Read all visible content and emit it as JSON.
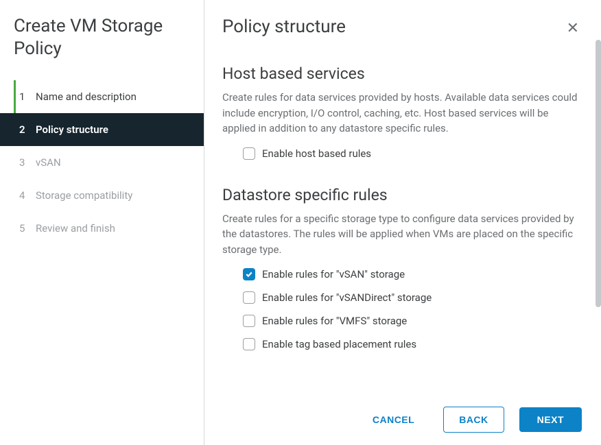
{
  "wizard": {
    "title": "Create VM Storage Policy"
  },
  "steps": [
    {
      "num": "1",
      "label": "Name and description",
      "state": "completed"
    },
    {
      "num": "2",
      "label": "Policy structure",
      "state": "active"
    },
    {
      "num": "3",
      "label": "vSAN",
      "state": "disabled"
    },
    {
      "num": "4",
      "label": "Storage compatibility",
      "state": "disabled"
    },
    {
      "num": "5",
      "label": "Review and finish",
      "state": "disabled"
    }
  ],
  "page": {
    "title": "Policy structure",
    "host_section": {
      "title": "Host based services",
      "desc": "Create rules for data services provided by hosts. Available data services could include encryption, I/O control, caching, etc. Host based services will be applied in addition to any datastore specific rules.",
      "checkbox_label": "Enable host based rules",
      "checked": false
    },
    "datastore_section": {
      "title": "Datastore specific rules",
      "desc": "Create rules for a specific storage type to configure data services provided by the datastores. The rules will be applied when VMs are placed on the specific storage type.",
      "options": [
        {
          "label": "Enable rules for \"vSAN\" storage",
          "checked": true
        },
        {
          "label": "Enable rules for \"vSANDirect\" storage",
          "checked": false
        },
        {
          "label": "Enable rules for \"VMFS\" storage",
          "checked": false
        },
        {
          "label": "Enable tag based placement rules",
          "checked": false
        }
      ]
    }
  },
  "footer": {
    "cancel": "CANCEL",
    "back": "BACK",
    "next": "NEXT"
  }
}
